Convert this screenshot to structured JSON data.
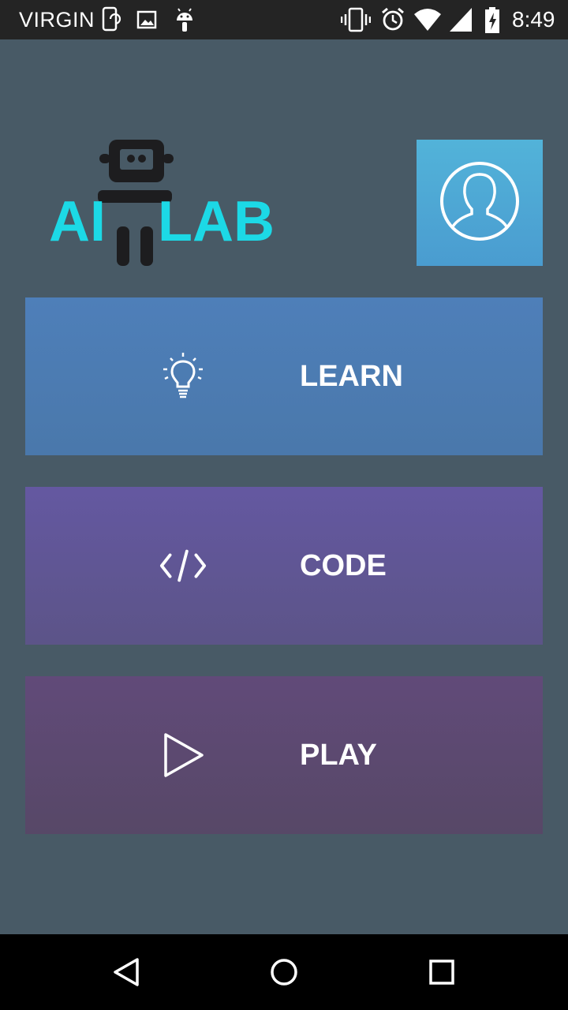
{
  "status_bar": {
    "carrier": "VIRGIN",
    "time": "8:49"
  },
  "logo": {
    "text_left": "AI",
    "text_right": "LAB",
    "accent_color": "#1cd9e6"
  },
  "menu": [
    {
      "label": "LEARN",
      "icon": "lightbulb-icon",
      "color": "#4e7fb9"
    },
    {
      "label": "CODE",
      "icon": "code-brackets-icon",
      "color": "#6458a1"
    },
    {
      "label": "PLAY",
      "icon": "play-icon",
      "color": "#614a79"
    }
  ],
  "profile": {
    "icon": "user-avatar-icon",
    "color": "#52b3d9"
  },
  "nav": {
    "back": "back-icon",
    "home": "home-icon",
    "recents": "recents-icon"
  }
}
